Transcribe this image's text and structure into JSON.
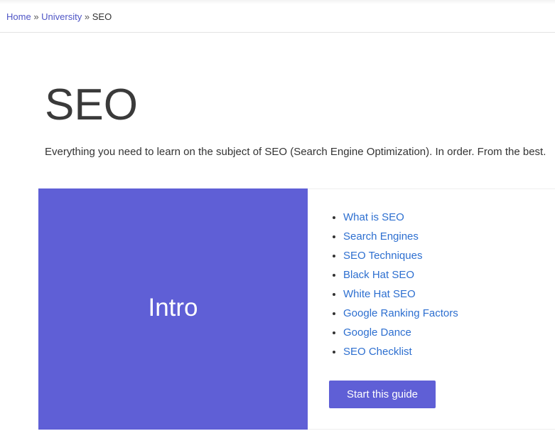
{
  "breadcrumb": {
    "items": [
      "Home",
      "University"
    ],
    "current": "SEO",
    "separator": "»"
  },
  "page": {
    "title": "SEO",
    "subtitle": "Everything you need to learn on the subject of SEO (Search Engine Optimization). In order. From the best."
  },
  "guide_card": {
    "hero_label": "Intro",
    "topics": [
      "What is SEO",
      "Search Engines",
      "SEO Techniques",
      "Black Hat SEO",
      "White Hat SEO",
      "Google Ranking Factors",
      "Google Dance",
      "SEO Checklist"
    ],
    "button_label": "Start this guide"
  },
  "colors": {
    "accent": "#5f5fd6",
    "link": "#2d6fd0",
    "breadcrumb_link": "#4f56c6"
  }
}
